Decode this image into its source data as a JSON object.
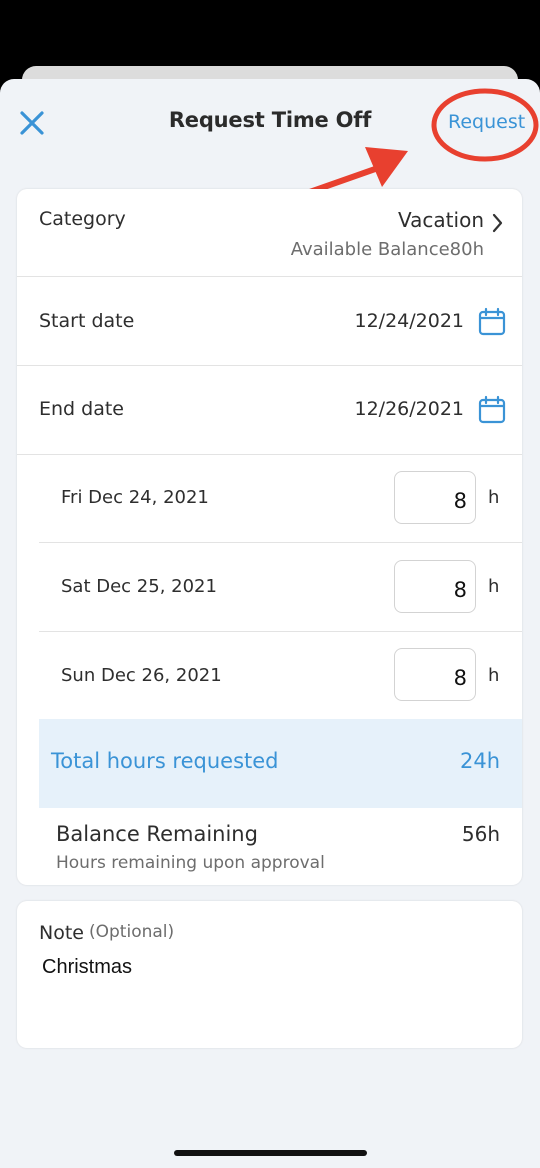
{
  "header": {
    "title": "Request Time Off",
    "request_label": "Request",
    "close_icon": "close-icon"
  },
  "form": {
    "category": {
      "label": "Category",
      "value": "Vacation",
      "balance_text": "Available Balance80h"
    },
    "start_date": {
      "label": "Start date",
      "value": "12/24/2021"
    },
    "end_date": {
      "label": "End date",
      "value": "12/26/2021"
    },
    "days": [
      {
        "label": "Fri Dec 24, 2021",
        "hours": "8",
        "unit": "h"
      },
      {
        "label": "Sat Dec 25, 2021",
        "hours": "8",
        "unit": "h"
      },
      {
        "label": "Sun Dec 26, 2021",
        "hours": "8",
        "unit": "h"
      }
    ],
    "total": {
      "label": "Total hours requested",
      "value": "24h"
    },
    "balance_remaining": {
      "label": "Balance Remaining",
      "value": "56h",
      "sub": "Hours remaining upon approval"
    }
  },
  "note": {
    "label": "Note",
    "optional": "(Optional)",
    "value": "Christmas"
  },
  "colors": {
    "accent": "#3a93d6",
    "annotation": "#e8402f",
    "sheet_bg": "#f0f3f7"
  }
}
